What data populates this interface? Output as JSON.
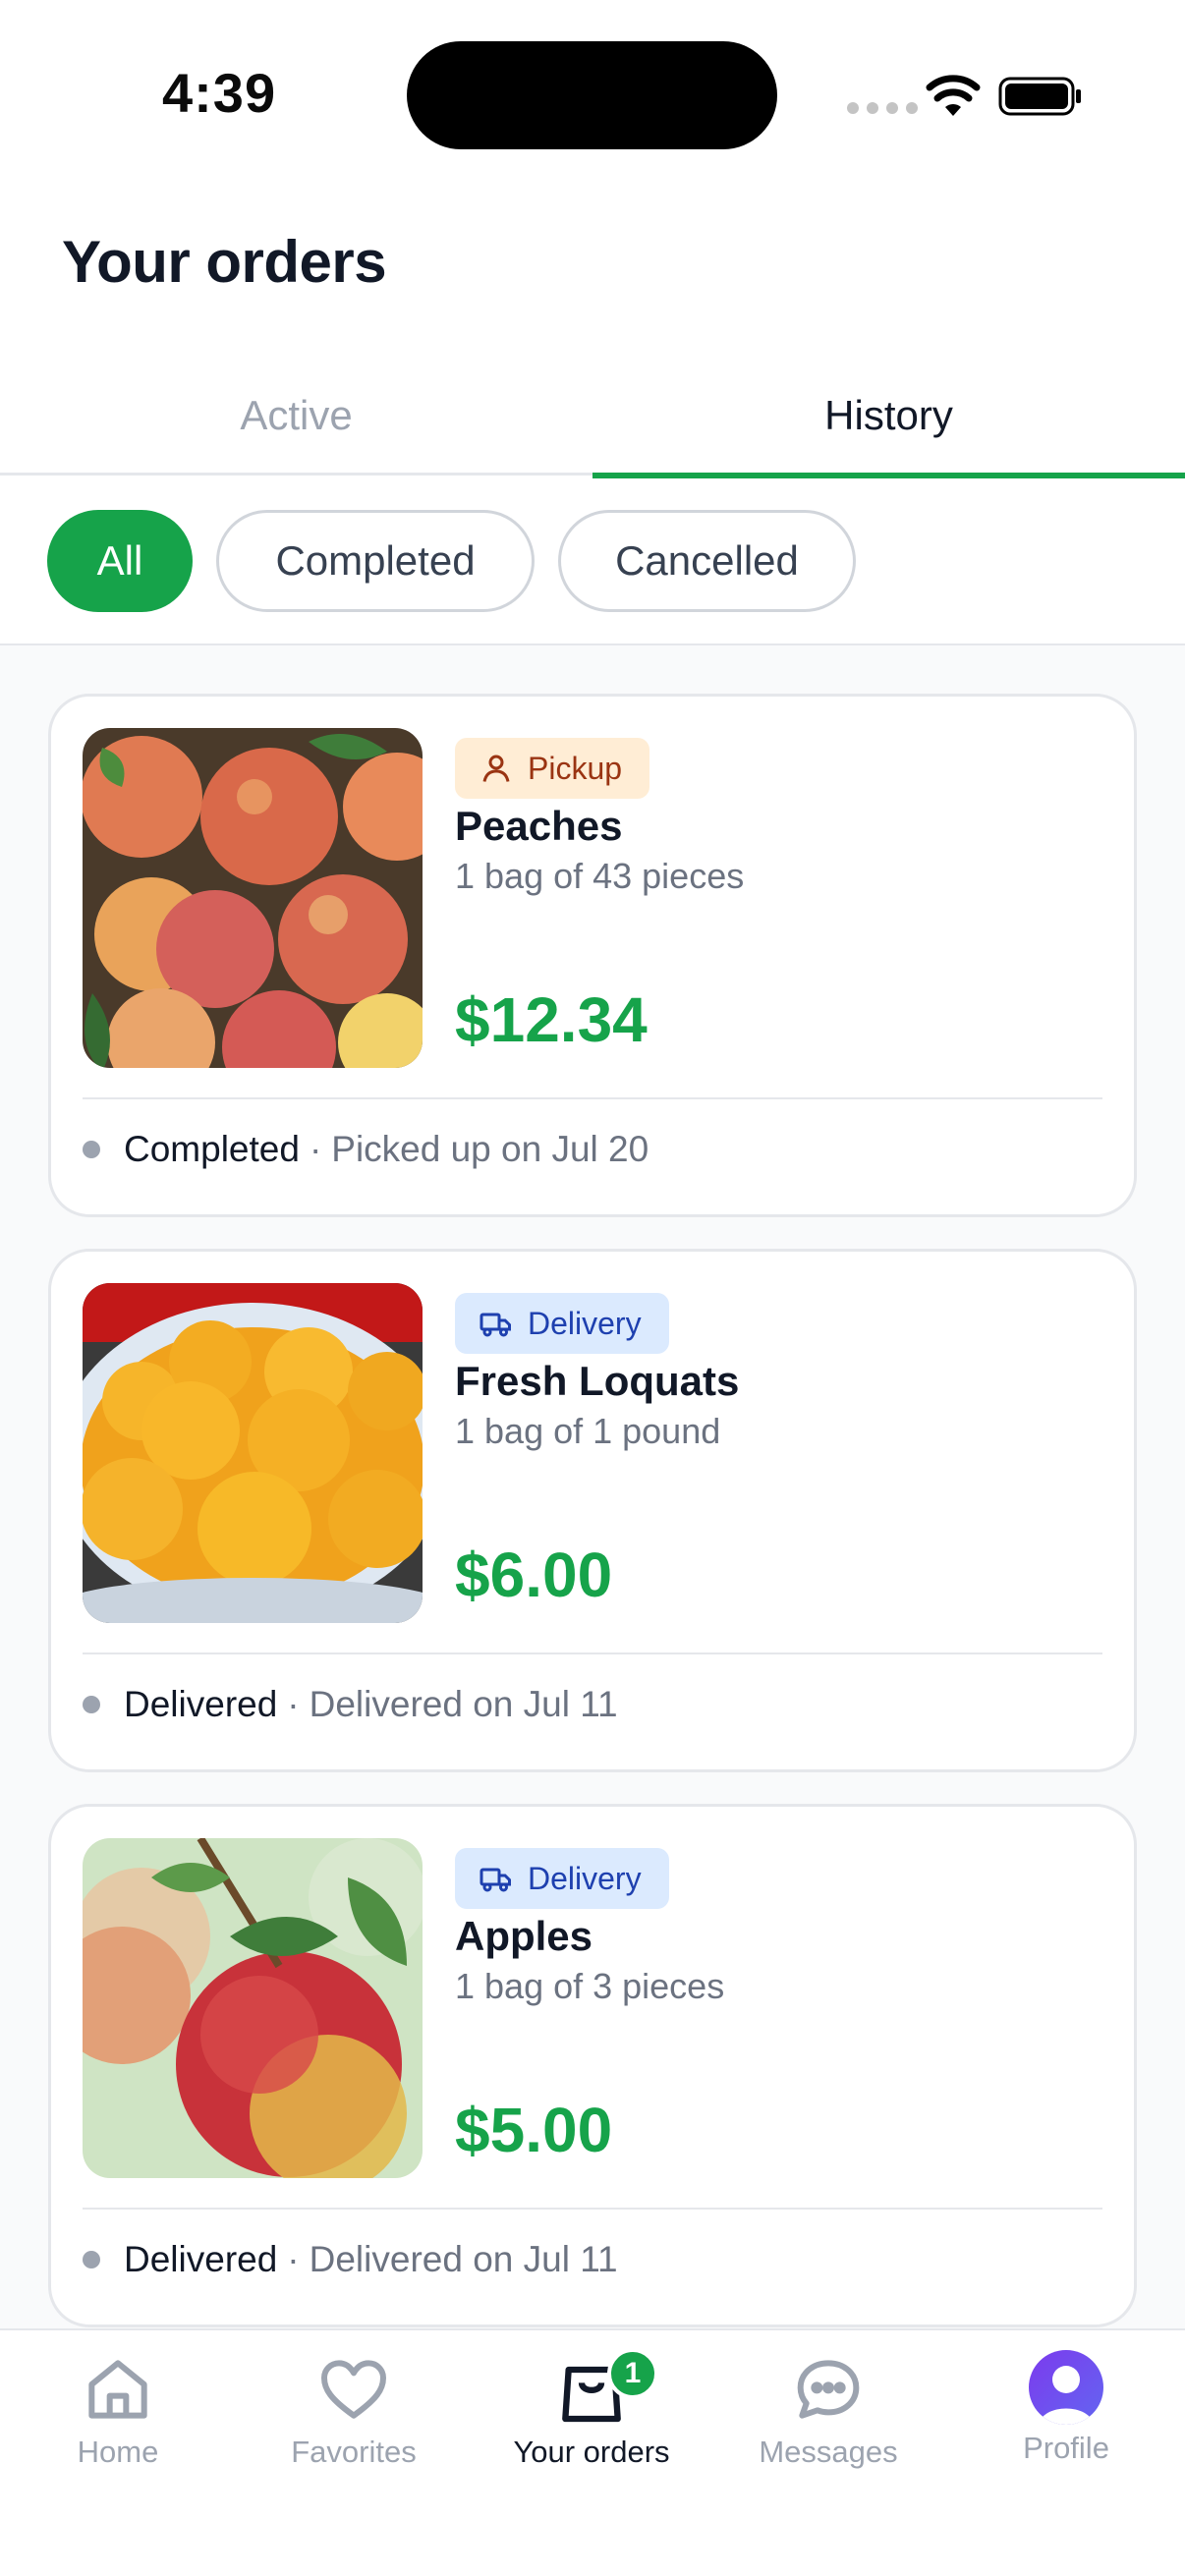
{
  "status_bar": {
    "time": "4:39"
  },
  "header": {
    "title": "Your orders"
  },
  "tabs": [
    {
      "label": "Active",
      "active": false
    },
    {
      "label": "History",
      "active": true
    }
  ],
  "filters": [
    {
      "label": "All",
      "selected": true
    },
    {
      "label": "Completed",
      "selected": false
    },
    {
      "label": "Cancelled",
      "selected": false
    }
  ],
  "orders": [
    {
      "image_icon": "peaches-photo",
      "method": "Pickup",
      "method_icon": "person-icon",
      "name": "Peaches",
      "quantity": "1 bag of 43 pieces",
      "price": "$12.34",
      "status": "Completed",
      "status_detail": "Picked up on Jul 20"
    },
    {
      "image_icon": "loquats-photo",
      "method": "Delivery",
      "method_icon": "truck-icon",
      "name": "Fresh Loquats",
      "quantity": "1 bag of 1 pound",
      "price": "$6.00",
      "status": "Delivered",
      "status_detail": "Delivered on Jul 11"
    },
    {
      "image_icon": "apples-photo",
      "method": "Delivery",
      "method_icon": "truck-icon",
      "name": "Apples",
      "quantity": "1 bag of 3 pieces",
      "price": "$5.00",
      "status": "Delivered",
      "status_detail": "Delivered on Jul 11"
    }
  ],
  "status_separator": "·",
  "bottom_nav": {
    "items": [
      {
        "label": "Home",
        "icon": "home-icon",
        "active": false
      },
      {
        "label": "Favorites",
        "icon": "heart-icon",
        "active": false
      },
      {
        "label": "Your orders",
        "icon": "shopping-bag-icon",
        "active": true,
        "badge": "1"
      },
      {
        "label": "Messages",
        "icon": "chat-bubble-icon",
        "active": false
      },
      {
        "label": "Profile",
        "icon": "avatar",
        "active": false
      }
    ]
  },
  "colors": {
    "accent": "#16a34a",
    "pickup_bg": "#ffedd5",
    "pickup_text": "#9a3412",
    "delivery_bg": "#dbeafe",
    "delivery_text": "#1e40af",
    "avatar": "#7c3aed"
  }
}
